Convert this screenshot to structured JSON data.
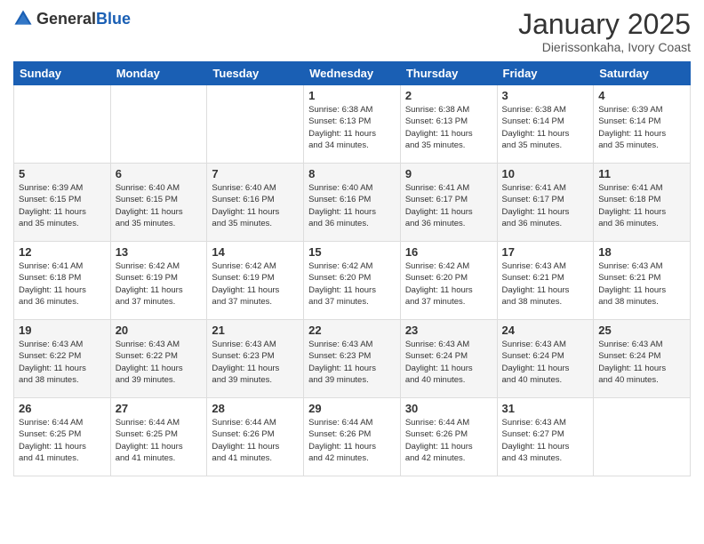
{
  "header": {
    "logo": {
      "general": "General",
      "blue": "Blue"
    },
    "title": "January 2025",
    "subtitle": "Dierissonkaha, Ivory Coast"
  },
  "days_of_week": [
    "Sunday",
    "Monday",
    "Tuesday",
    "Wednesday",
    "Thursday",
    "Friday",
    "Saturday"
  ],
  "weeks": [
    [
      {
        "day": "",
        "info": ""
      },
      {
        "day": "",
        "info": ""
      },
      {
        "day": "",
        "info": ""
      },
      {
        "day": "1",
        "info": "Sunrise: 6:38 AM\nSunset: 6:13 PM\nDaylight: 11 hours\nand 34 minutes."
      },
      {
        "day": "2",
        "info": "Sunrise: 6:38 AM\nSunset: 6:13 PM\nDaylight: 11 hours\nand 35 minutes."
      },
      {
        "day": "3",
        "info": "Sunrise: 6:38 AM\nSunset: 6:14 PM\nDaylight: 11 hours\nand 35 minutes."
      },
      {
        "day": "4",
        "info": "Sunrise: 6:39 AM\nSunset: 6:14 PM\nDaylight: 11 hours\nand 35 minutes."
      }
    ],
    [
      {
        "day": "5",
        "info": "Sunrise: 6:39 AM\nSunset: 6:15 PM\nDaylight: 11 hours\nand 35 minutes."
      },
      {
        "day": "6",
        "info": "Sunrise: 6:40 AM\nSunset: 6:15 PM\nDaylight: 11 hours\nand 35 minutes."
      },
      {
        "day": "7",
        "info": "Sunrise: 6:40 AM\nSunset: 6:16 PM\nDaylight: 11 hours\nand 35 minutes."
      },
      {
        "day": "8",
        "info": "Sunrise: 6:40 AM\nSunset: 6:16 PM\nDaylight: 11 hours\nand 36 minutes."
      },
      {
        "day": "9",
        "info": "Sunrise: 6:41 AM\nSunset: 6:17 PM\nDaylight: 11 hours\nand 36 minutes."
      },
      {
        "day": "10",
        "info": "Sunrise: 6:41 AM\nSunset: 6:17 PM\nDaylight: 11 hours\nand 36 minutes."
      },
      {
        "day": "11",
        "info": "Sunrise: 6:41 AM\nSunset: 6:18 PM\nDaylight: 11 hours\nand 36 minutes."
      }
    ],
    [
      {
        "day": "12",
        "info": "Sunrise: 6:41 AM\nSunset: 6:18 PM\nDaylight: 11 hours\nand 36 minutes."
      },
      {
        "day": "13",
        "info": "Sunrise: 6:42 AM\nSunset: 6:19 PM\nDaylight: 11 hours\nand 37 minutes."
      },
      {
        "day": "14",
        "info": "Sunrise: 6:42 AM\nSunset: 6:19 PM\nDaylight: 11 hours\nand 37 minutes."
      },
      {
        "day": "15",
        "info": "Sunrise: 6:42 AM\nSunset: 6:20 PM\nDaylight: 11 hours\nand 37 minutes."
      },
      {
        "day": "16",
        "info": "Sunrise: 6:42 AM\nSunset: 6:20 PM\nDaylight: 11 hours\nand 37 minutes."
      },
      {
        "day": "17",
        "info": "Sunrise: 6:43 AM\nSunset: 6:21 PM\nDaylight: 11 hours\nand 38 minutes."
      },
      {
        "day": "18",
        "info": "Sunrise: 6:43 AM\nSunset: 6:21 PM\nDaylight: 11 hours\nand 38 minutes."
      }
    ],
    [
      {
        "day": "19",
        "info": "Sunrise: 6:43 AM\nSunset: 6:22 PM\nDaylight: 11 hours\nand 38 minutes."
      },
      {
        "day": "20",
        "info": "Sunrise: 6:43 AM\nSunset: 6:22 PM\nDaylight: 11 hours\nand 39 minutes."
      },
      {
        "day": "21",
        "info": "Sunrise: 6:43 AM\nSunset: 6:23 PM\nDaylight: 11 hours\nand 39 minutes."
      },
      {
        "day": "22",
        "info": "Sunrise: 6:43 AM\nSunset: 6:23 PM\nDaylight: 11 hours\nand 39 minutes."
      },
      {
        "day": "23",
        "info": "Sunrise: 6:43 AM\nSunset: 6:24 PM\nDaylight: 11 hours\nand 40 minutes."
      },
      {
        "day": "24",
        "info": "Sunrise: 6:43 AM\nSunset: 6:24 PM\nDaylight: 11 hours\nand 40 minutes."
      },
      {
        "day": "25",
        "info": "Sunrise: 6:43 AM\nSunset: 6:24 PM\nDaylight: 11 hours\nand 40 minutes."
      }
    ],
    [
      {
        "day": "26",
        "info": "Sunrise: 6:44 AM\nSunset: 6:25 PM\nDaylight: 11 hours\nand 41 minutes."
      },
      {
        "day": "27",
        "info": "Sunrise: 6:44 AM\nSunset: 6:25 PM\nDaylight: 11 hours\nand 41 minutes."
      },
      {
        "day": "28",
        "info": "Sunrise: 6:44 AM\nSunset: 6:26 PM\nDaylight: 11 hours\nand 41 minutes."
      },
      {
        "day": "29",
        "info": "Sunrise: 6:44 AM\nSunset: 6:26 PM\nDaylight: 11 hours\nand 42 minutes."
      },
      {
        "day": "30",
        "info": "Sunrise: 6:44 AM\nSunset: 6:26 PM\nDaylight: 11 hours\nand 42 minutes."
      },
      {
        "day": "31",
        "info": "Sunrise: 6:43 AM\nSunset: 6:27 PM\nDaylight: 11 hours\nand 43 minutes."
      },
      {
        "day": "",
        "info": ""
      }
    ]
  ]
}
